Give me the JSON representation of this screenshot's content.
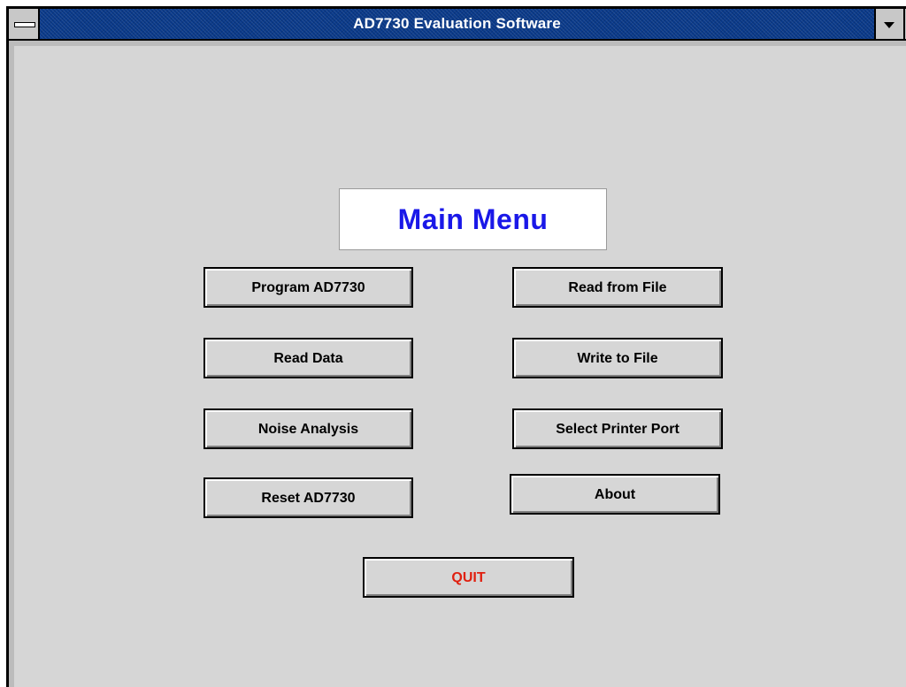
{
  "window": {
    "title": "AD7730 Evaluation Software"
  },
  "main": {
    "heading": "Main Menu",
    "buttons": {
      "program": "Program AD7730",
      "read_data": "Read Data",
      "noise_analysis": "Noise Analysis",
      "reset": "Reset AD7730",
      "read_from_file": "Read from File",
      "write_to_file": "Write to File",
      "select_printer_port": "Select Printer Port",
      "about": "About",
      "quit": "QUIT"
    }
  },
  "colors": {
    "titlebar": "#0a3a8a",
    "heading_text": "#1a18e8",
    "quit_text": "#e02010",
    "face": "#d6d6d6"
  },
  "icons": {
    "system_menu": "system-menu-icon",
    "minimize": "minimize-arrow-icon",
    "maximize": "maximize-arrow-icon"
  }
}
